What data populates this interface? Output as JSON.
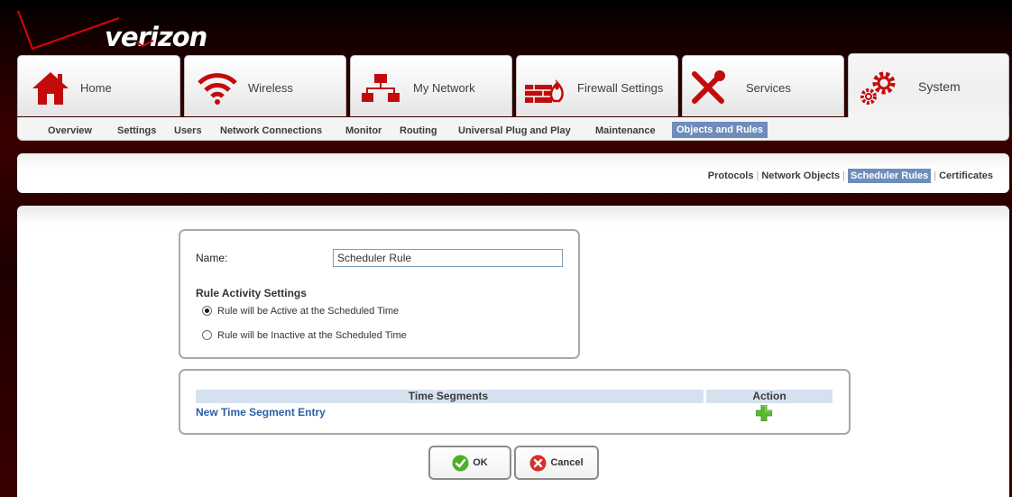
{
  "brand": {
    "name": "verizon"
  },
  "tabs": [
    {
      "label": "Home",
      "icon": "home-icon"
    },
    {
      "label": "Wireless",
      "icon": "wireless-icon"
    },
    {
      "label": "My Network",
      "icon": "network-icon"
    },
    {
      "label": "Firewall Settings",
      "icon": "firewall-icon"
    },
    {
      "label": "Services",
      "icon": "tools-icon"
    },
    {
      "label": "System",
      "icon": "gears-icon",
      "active": true
    }
  ],
  "subnav": [
    "Overview",
    "Settings",
    "Users",
    "Network Connections",
    "Monitor",
    "Routing",
    "Universal Plug and Play",
    "Maintenance",
    "Objects and Rules"
  ],
  "subnav_active": "Objects and Rules",
  "sublinks": [
    "Protocols",
    "Network Objects",
    "Scheduler Rules",
    "Certificates"
  ],
  "sublinks_active": "Scheduler Rules",
  "form": {
    "name_label": "Name:",
    "name_value": "Scheduler Rule",
    "section_title": "Rule Activity Settings",
    "option_active": "Rule will be Active at the Scheduled Time",
    "option_inactive": "Rule will be Inactive at the Scheduled Time",
    "selected": "active"
  },
  "time_segments": {
    "col_segments": "Time Segments",
    "col_action": "Action",
    "new_entry": "New Time Segment Entry"
  },
  "buttons": {
    "ok": "OK",
    "cancel": "Cancel"
  },
  "colors": {
    "brand_red": "#cd040b",
    "highlight": "#6f8dbb",
    "link": "#2b60a8"
  }
}
